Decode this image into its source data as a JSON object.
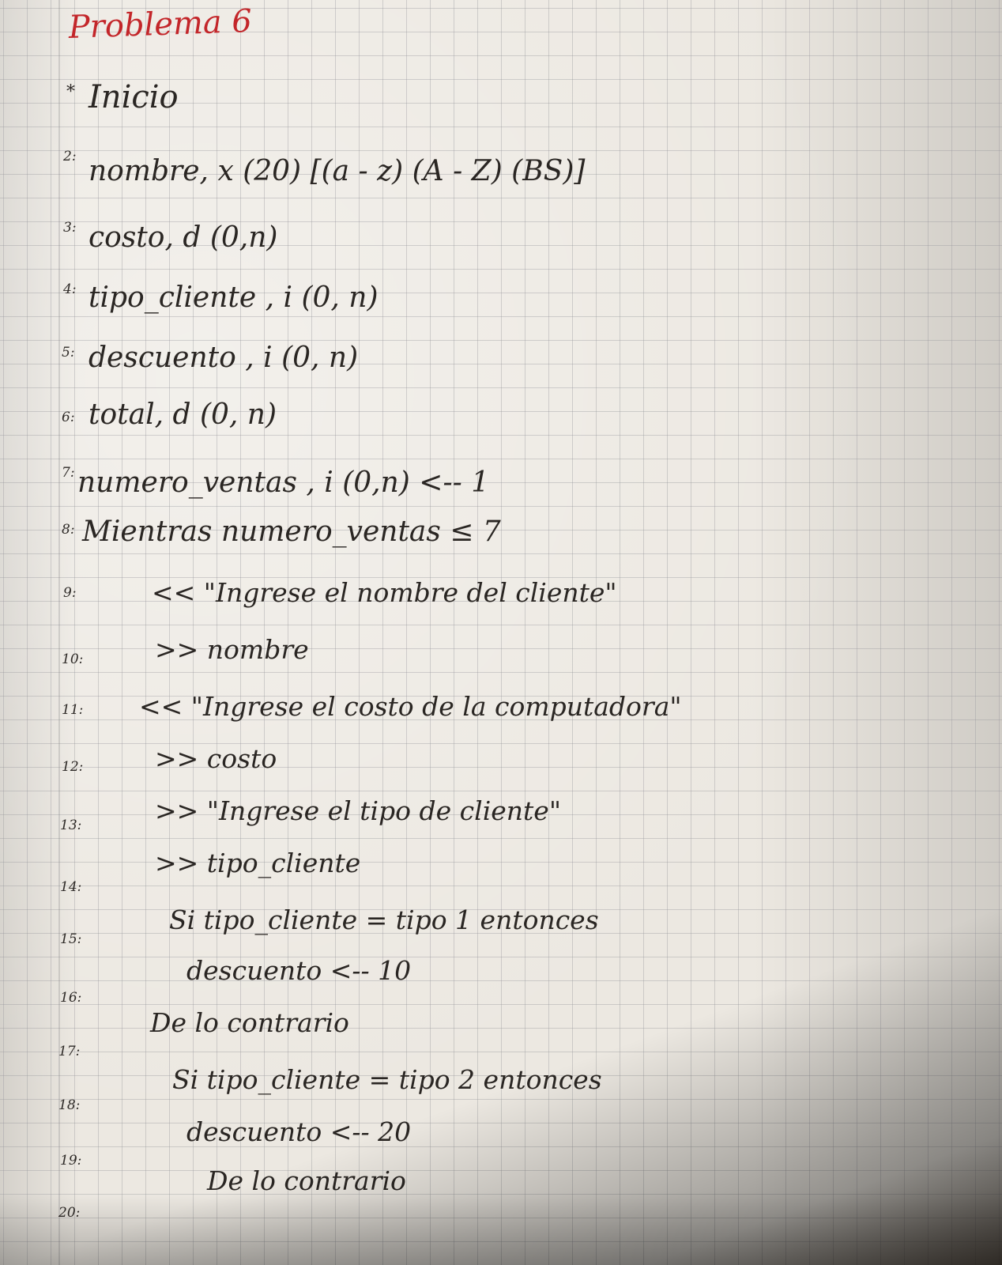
{
  "title": "Problema 6",
  "lines": [
    {
      "num": "*",
      "text": "Inicio"
    },
    {
      "num": "2:",
      "text": "nombre, x (20) [(a - z) (A - Z) (BS)]"
    },
    {
      "num": "3:",
      "text": "costo, d (0,n)"
    },
    {
      "num": "4:",
      "text": "tipo_cliente , i (0, n)"
    },
    {
      "num": "5:",
      "text": "descuento , i (0, n)"
    },
    {
      "num": "6:",
      "text": "total, d (0, n)"
    },
    {
      "num": "7:",
      "text": "numero_ventas , i (0,n) <-- 1"
    },
    {
      "num": "8:",
      "text": "Mientras numero_ventas ≤ 7"
    },
    {
      "num": "9:",
      "text": "<< \"Ingrese el nombre del cliente\""
    },
    {
      "num": "10:",
      "text": ">> nombre"
    },
    {
      "num": "11:",
      "text": "<< \"Ingrese el costo de la computadora\""
    },
    {
      "num": "12:",
      "text": ">> costo"
    },
    {
      "num": "13:",
      "text": ">> \"Ingrese el tipo de cliente\""
    },
    {
      "num": "14:",
      "text": ">> tipo_cliente"
    },
    {
      "num": "15:",
      "text": "Si tipo_cliente = tipo 1 entonces"
    },
    {
      "num": "16:",
      "text": "descuento <-- 10"
    },
    {
      "num": "17:",
      "text": "De lo contrario"
    },
    {
      "num": "18:",
      "text": "Si tipo_cliente = tipo 2 entonces"
    },
    {
      "num": "19:",
      "text": "descuento <-- 20"
    },
    {
      "num": "20:",
      "text": "De lo contrario"
    }
  ]
}
